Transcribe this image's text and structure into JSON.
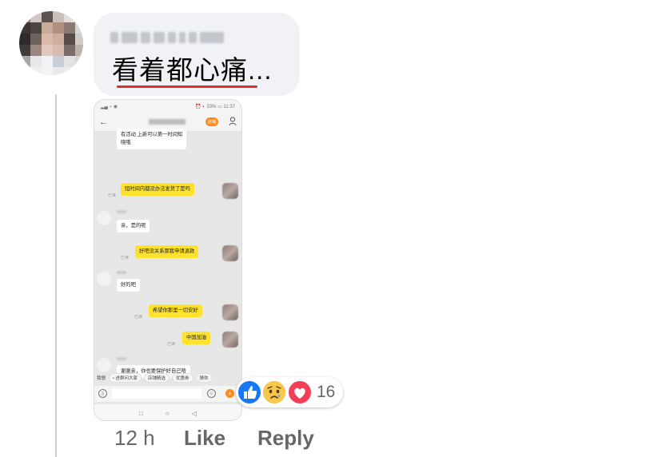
{
  "comment": {
    "author_name": "",
    "text": "看着都心痛...",
    "timestamp": "12 h",
    "like_label": "Like",
    "reply_label": "Reply"
  },
  "reactions": {
    "count": "16",
    "types": [
      "like-icon",
      "sad-icon",
      "love-icon"
    ],
    "colors": {
      "like": "#1877f2",
      "sad": "#f7c84a",
      "love": "#f33e58"
    }
  },
  "attachment": {
    "status_bar": {
      "left": "▂▄ ⌁ ◉",
      "right": "⏰ ◐ 33% ▭ 11:37"
    },
    "header": {
      "shop_badge": "店铺"
    },
    "messages": [
      {
        "dir": "in",
        "text": "有活动 上新可以第一时间知\n晓哦"
      },
      {
        "dir": "out",
        "text": "短时间内都没办法发货了是吗",
        "read": "已读"
      },
      {
        "dir": "in",
        "text": "亲，是的呢"
      },
      {
        "dir": "out",
        "text": "好吧没关系那我申请退款",
        "read": "已读"
      },
      {
        "dir": "in",
        "text": "好的吧"
      },
      {
        "dir": "out",
        "text": "希望你那里一切安好",
        "read": "已读"
      },
      {
        "dir": "out",
        "text": "中国加油",
        "read": "已读"
      },
      {
        "dir": "in",
        "text": "谢谢亲，你也要保护好自己哈"
      }
    ],
    "quick_replies": [
      "我想",
      "进群问大家",
      "店铺精选",
      "优惠券",
      "猜你"
    ],
    "nav": [
      "◁",
      "○",
      "□"
    ]
  },
  "colors": {
    "bubble_bg": "#f0f2f5",
    "text_secondary": "#65676b",
    "outgoing_msg": "#ffe22b",
    "shop_accent": "#ff8a1e"
  }
}
